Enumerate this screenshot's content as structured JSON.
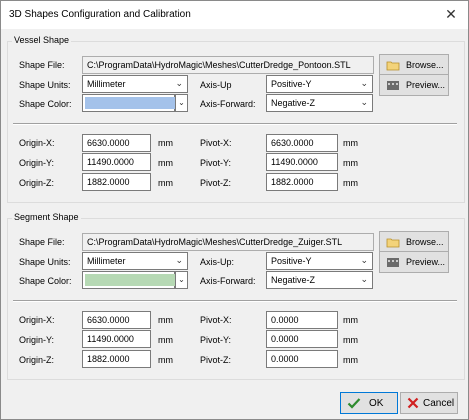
{
  "window": {
    "title": "3D Shapes Configuration and Calibration",
    "close_glyph": "✕"
  },
  "vessel": {
    "group_label": "Vessel Shape",
    "shape_file_label": "Shape File:",
    "shape_file": "C:\\ProgramData\\HydroMagic\\Meshes\\CutterDredge_Pontoon.STL",
    "browse_label": "Browse...",
    "preview_label": "Preview...",
    "units_label": "Shape Units:",
    "units_value": "Millimeter",
    "axis_up_label": "Axis-Up",
    "axis_up_value": "Positive-Y",
    "color_label": "Shape Color:",
    "color": "#a4c2ea",
    "axis_forward_label": "Axis-Forward:",
    "axis_forward_value": "Negative-Z",
    "origin_x_label": "Origin-X:",
    "origin_x": "6630.0000",
    "origin_y_label": "Origin-Y:",
    "origin_y": "11490.0000",
    "origin_z_label": "Origin-Z:",
    "origin_z": "1882.0000",
    "pivot_x_label": "Pivot-X:",
    "pivot_x": "6630.0000",
    "pivot_y_label": "Pivot-Y:",
    "pivot_y": "11490.0000",
    "pivot_z_label": "Pivot-Z:",
    "pivot_z": "1882.0000",
    "unit": "mm"
  },
  "segment": {
    "group_label": "Segment Shape",
    "shape_file_label": "Shape File:",
    "shape_file": "C:\\ProgramData\\HydroMagic\\Meshes\\CutterDredge_Zuiger.STL",
    "browse_label": "Browse...",
    "preview_label": "Preview...",
    "units_label": "Shape Units:",
    "units_value": "Millimeter",
    "axis_up_label": "Axis-Up:",
    "axis_up_value": "Positive-Y",
    "color_label": "Shape Color:",
    "color": "#b6d9b4",
    "axis_forward_label": "Axis-Forward:",
    "axis_forward_value": "Negative-Z",
    "origin_x_label": "Origin-X:",
    "origin_x": "6630.0000",
    "origin_y_label": "Origin-Y:",
    "origin_y": "11490.0000",
    "origin_z_label": "Origin-Z:",
    "origin_z": "1882.0000",
    "pivot_x_label": "Pivot-X:",
    "pivot_x": "0.0000",
    "pivot_y_label": "Pivot-Y:",
    "pivot_y": "0.0000",
    "pivot_z_label": "Pivot-Z:",
    "pivot_z": "0.0000",
    "unit": "mm"
  },
  "footer": {
    "ok_label": "OK",
    "cancel_label": "Cancel"
  }
}
